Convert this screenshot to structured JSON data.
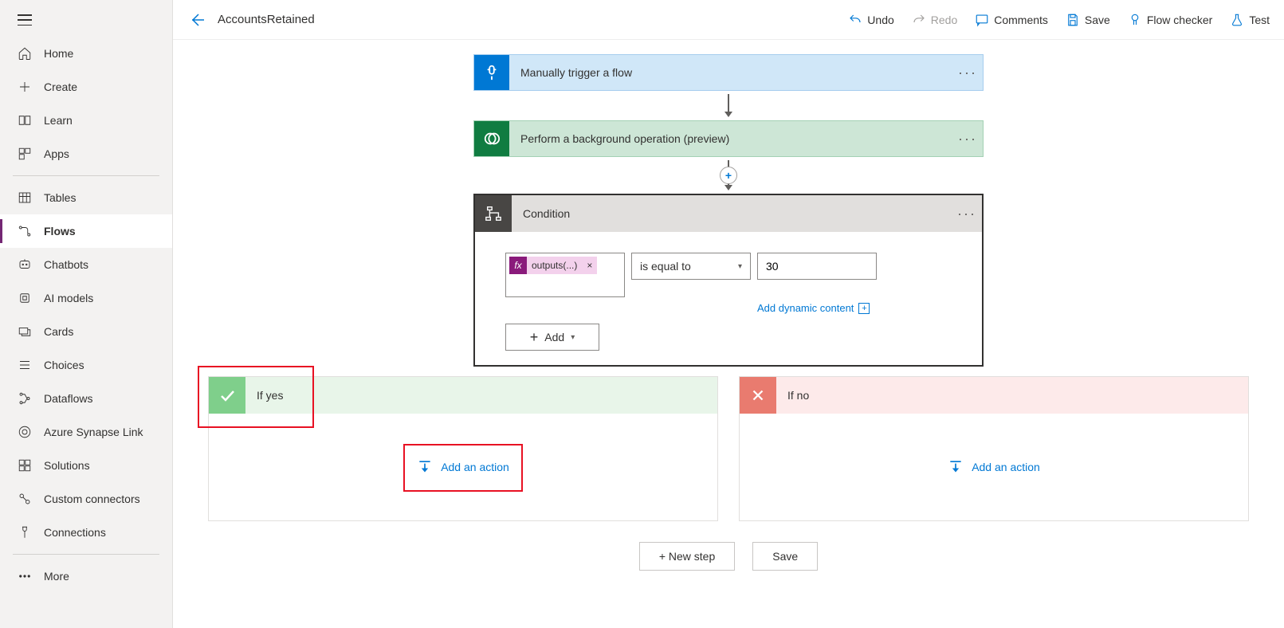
{
  "sidebar": {
    "groups": [
      {
        "items": [
          {
            "key": "home",
            "label": "Home",
            "icon": "home"
          },
          {
            "key": "create",
            "label": "Create",
            "icon": "plus"
          },
          {
            "key": "learn",
            "label": "Learn",
            "icon": "book"
          },
          {
            "key": "apps",
            "label": "Apps",
            "icon": "apps"
          }
        ]
      },
      {
        "items": [
          {
            "key": "tables",
            "label": "Tables",
            "icon": "table"
          },
          {
            "key": "flows",
            "label": "Flows",
            "icon": "flow",
            "active": true
          },
          {
            "key": "chatbots",
            "label": "Chatbots",
            "icon": "chatbot"
          },
          {
            "key": "aimodels",
            "label": "AI models",
            "icon": "ai"
          },
          {
            "key": "cards",
            "label": "Cards",
            "icon": "cards"
          },
          {
            "key": "choices",
            "label": "Choices",
            "icon": "choices"
          },
          {
            "key": "dataflows",
            "label": "Dataflows",
            "icon": "dataflows"
          },
          {
            "key": "synapse",
            "label": "Azure Synapse Link",
            "icon": "synapse"
          },
          {
            "key": "solutions",
            "label": "Solutions",
            "icon": "solutions"
          },
          {
            "key": "connectors",
            "label": "Custom connectors",
            "icon": "connectors"
          },
          {
            "key": "connections",
            "label": "Connections",
            "icon": "connections"
          }
        ]
      },
      {
        "items": [
          {
            "key": "more",
            "label": "More",
            "icon": "more"
          }
        ]
      }
    ]
  },
  "header": {
    "title": "AccountsRetained",
    "actions": {
      "undo": "Undo",
      "redo": "Redo",
      "comments": "Comments",
      "save": "Save",
      "flowchecker": "Flow checker",
      "test": "Test"
    }
  },
  "flow": {
    "trigger": {
      "title": "Manually trigger a flow"
    },
    "bgop": {
      "title": "Perform a background operation (preview)"
    },
    "condition": {
      "title": "Condition",
      "left_token": "outputs(...)",
      "operator": "is equal to",
      "right_value": "30",
      "add_dynamic": "Add dynamic content",
      "add_label": "Add"
    },
    "branches": {
      "yes": {
        "title": "If yes",
        "action_label": "Add an action"
      },
      "no": {
        "title": "If no",
        "action_label": "Add an action"
      }
    },
    "bottom": {
      "new_step": "+ New step",
      "save": "Save"
    }
  }
}
